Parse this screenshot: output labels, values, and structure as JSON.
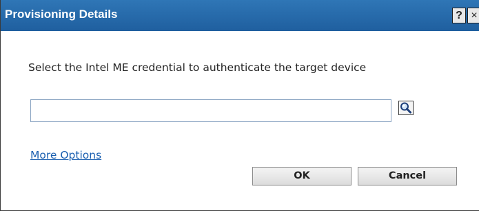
{
  "dialog": {
    "title": "Provisioning Details",
    "help_label": "?",
    "close_label": "×",
    "prompt": "Select the Intel ME credential to authenticate the target device",
    "credential_input": {
      "value": "",
      "placeholder": ""
    },
    "browse_icon": "search-icon",
    "more_options_label": "More Options",
    "ok_label": "OK",
    "cancel_label": "Cancel"
  },
  "colors": {
    "titlebar": "#2a6fae",
    "link": "#1a5fb0",
    "input_border": "#8aa4c2"
  }
}
